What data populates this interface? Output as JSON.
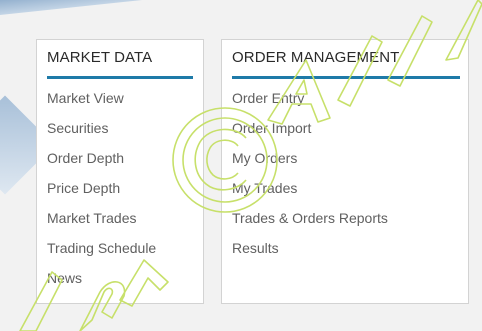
{
  "market_data": {
    "title": "MARKET DATA",
    "items": [
      {
        "label": "Market View"
      },
      {
        "label": "Securities"
      },
      {
        "label": "Order Depth"
      },
      {
        "label": "Price Depth"
      },
      {
        "label": "Market Trades"
      },
      {
        "label": "Trading Schedule"
      },
      {
        "label": "News"
      }
    ]
  },
  "order_management": {
    "title": "ORDER MANAGEMENT",
    "items": [
      {
        "label": "Order Entry"
      },
      {
        "label": "Order Import"
      },
      {
        "label": "My Orders"
      },
      {
        "label": "My Trades"
      },
      {
        "label": "Trades & Orders Reports"
      },
      {
        "label": "Results"
      }
    ]
  },
  "colors": {
    "accent": "#1e7aa8",
    "panel_border": "#d3d3d3",
    "background": "#f2f2f2",
    "text": "#606060",
    "watermark": "#c7e06a"
  },
  "watermark": {
    "visible": true,
    "icon": "copyright-icon"
  }
}
